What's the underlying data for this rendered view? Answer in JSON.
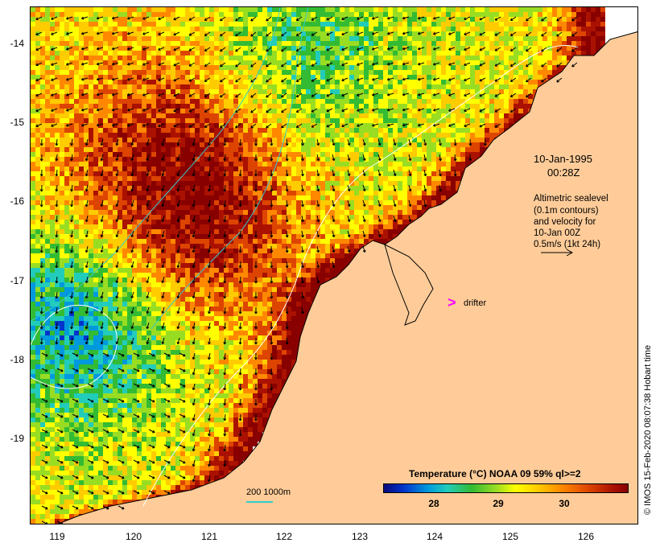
{
  "map": {
    "lon_ticks": [
      "119",
      "120",
      "121",
      "122",
      "123",
      "124",
      "125",
      "126"
    ],
    "lat_ticks": [
      "-14",
      "-15",
      "-16",
      "-17",
      "-18",
      "-19"
    ],
    "lon_range": [
      118.6,
      126.7
    ],
    "lat_range": [
      -13.6,
      -20.1
    ]
  },
  "timestamp": {
    "date": "10-Jan-1995",
    "time": "00:28Z"
  },
  "info": {
    "line1": "Altimetric sealevel",
    "line2": "(0.1m contours)",
    "line3": "and velocity for",
    "line4": "10-Jan 00Z",
    "line5": "0.5m/s (1kt 24h)"
  },
  "drifter": {
    "marker": ">",
    "label": "drifter",
    "color": "#ff00ff"
  },
  "colorbar": {
    "title": "Temperature (°C) NOAA 09 59% ql>=2",
    "ticks": [
      "28",
      "29",
      "30"
    ],
    "tick_values": [
      28,
      29,
      30
    ],
    "range": [
      27.1,
      30.9
    ]
  },
  "depth_legend": {
    "text": "200  1000m",
    "color": "#33cccc"
  },
  "credit": "© IMOS 15-Feb-2020 08:07:38 Hobart time",
  "colors": {
    "land": "#ffcc99",
    "coast": "#000000",
    "contour": "#ffffff",
    "bathy": "#33cccc",
    "arrow": "#000000"
  }
}
